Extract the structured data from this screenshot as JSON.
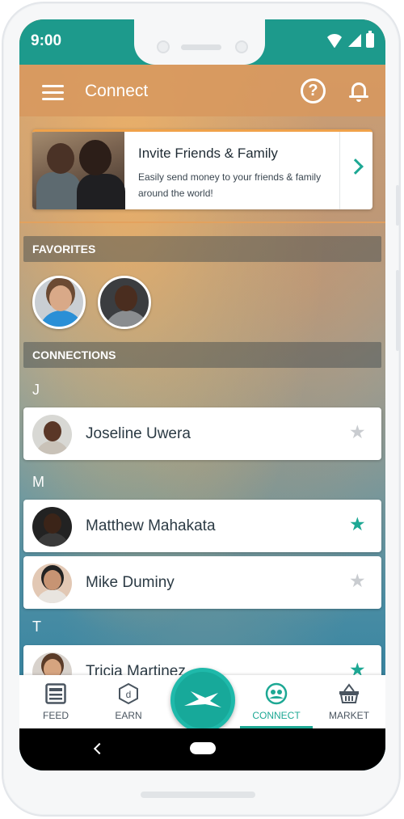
{
  "status": {
    "time": "9:00"
  },
  "appbar": {
    "title": "Connect",
    "help_glyph": "?"
  },
  "invite": {
    "title": "Invite Friends & Family",
    "subtitle": "Easily send money to your friends & family around the world!"
  },
  "favorites": {
    "header": "FAVORITES"
  },
  "connections": {
    "header": "CONNECTIONS",
    "groups": [
      {
        "letter": "J",
        "items": [
          {
            "name": "Joseline Uwera",
            "starred": false
          }
        ]
      },
      {
        "letter": "M",
        "items": [
          {
            "name": "Matthew Mahakata",
            "starred": true
          },
          {
            "name": "Mike Duminy",
            "starred": false
          }
        ]
      },
      {
        "letter": "T",
        "items": [
          {
            "name": "Tricia Martinez",
            "starred": true
          }
        ]
      }
    ]
  },
  "nav": {
    "feed": "FEED",
    "earn": "EARN",
    "connect": "CONNECT",
    "market": "MARKET"
  },
  "colors": {
    "accent": "#1da894",
    "star_on": "#1da894",
    "star_off": "#c9ccd0"
  }
}
